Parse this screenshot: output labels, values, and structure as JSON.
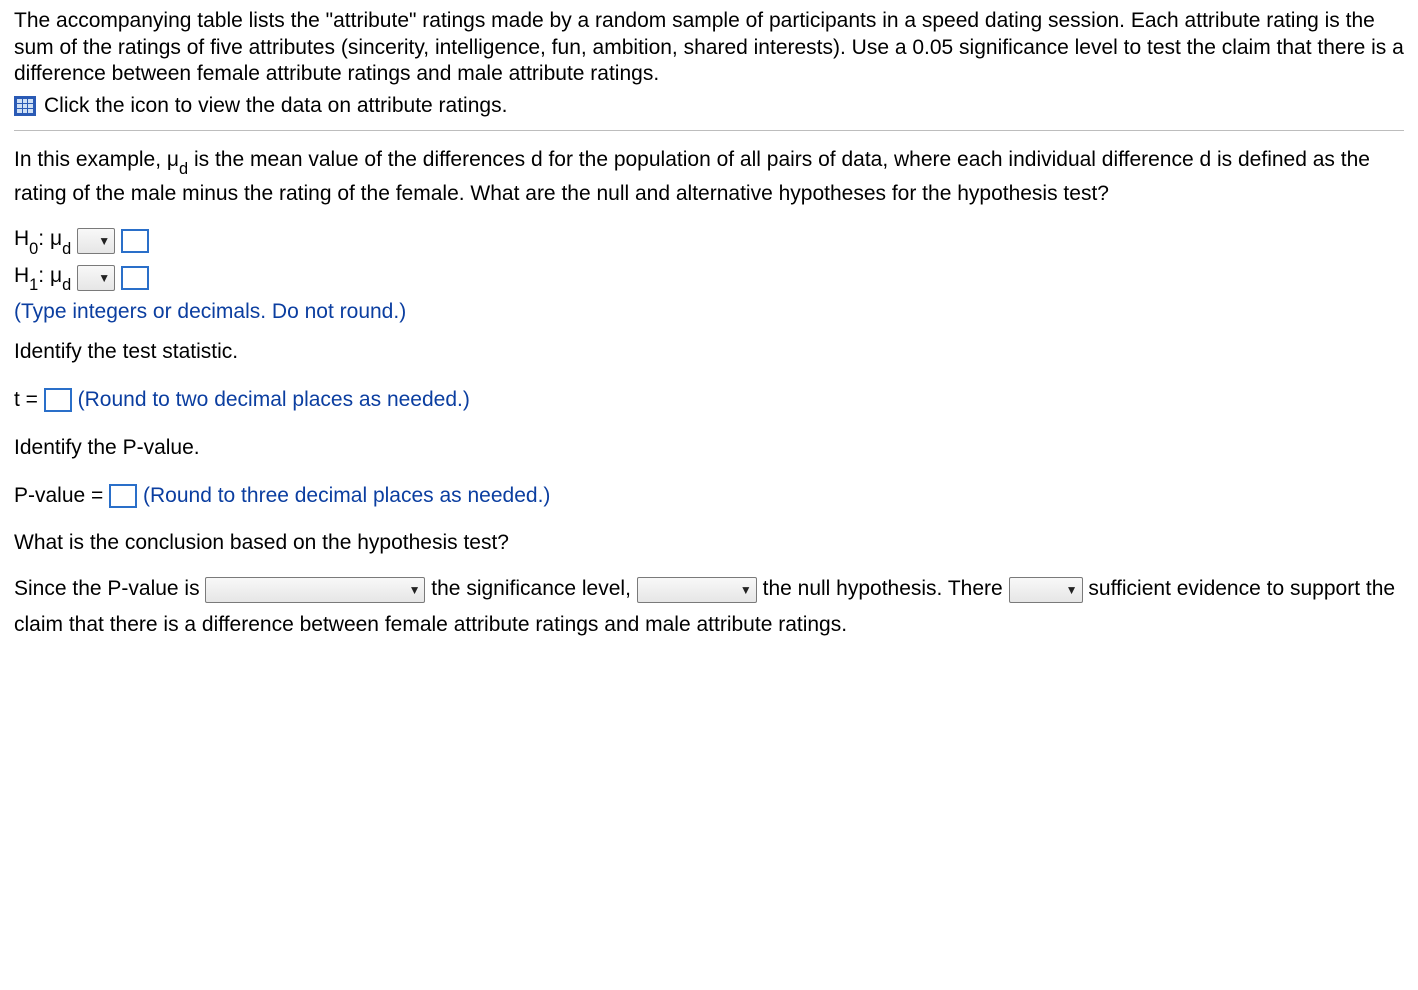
{
  "intro": "The accompanying table lists the \"attribute\" ratings made by a random sample of participants in a speed dating session. Each attribute rating is the sum of the ratings of five attributes (sincerity, intelligence, fun, ambition, shared interests). Use a 0.05 significance level to test the claim that there is a difference between female attribute ratings and male attribute ratings.",
  "icon_instruction": "Click the icon to view the data on attribute ratings.",
  "context": {
    "pre": "In this example, ",
    "mu": "μ",
    "mu_sub": "d",
    "post": " is the mean value of the differences d for the population of all pairs of data, where each individual difference d is defined as the rating of the male minus the rating of the female. What are the null and alternative hypotheses for the hypothesis test?"
  },
  "hypotheses": {
    "h0_label_left": "H",
    "h0_sub": "0",
    "h0_colon": ": μ",
    "h0_mu_sub": "d",
    "h1_label_left": "H",
    "h1_sub": "1",
    "h1_colon": ": μ",
    "h1_mu_sub": "d",
    "hint": "(Type integers or decimals. Do not round.)"
  },
  "test_stat": {
    "prompt": "Identify the test statistic.",
    "label": "t =",
    "hint": "(Round to two decimal places as needed.)"
  },
  "pvalue": {
    "prompt": "Identify the P-value.",
    "label": "P-value =",
    "hint": "(Round to three decimal places as needed.)"
  },
  "conclusion": {
    "prompt": "What is the conclusion based on the hypothesis test?",
    "seg1": "Since the P-value is",
    "seg2": "the significance level,",
    "seg3": "the null hypothesis. There",
    "seg4": "sufficient evidence to support the claim that there is a difference between female attribute ratings and male attribute ratings."
  }
}
